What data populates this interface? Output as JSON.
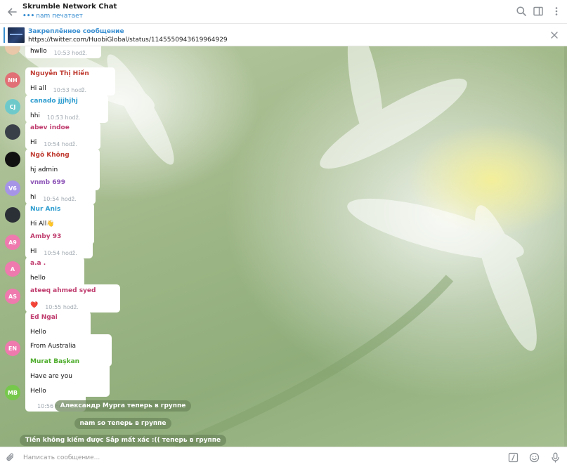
{
  "header": {
    "title": "Skrumble Network Chat",
    "typing_dots": "•••",
    "status": "nam печатает"
  },
  "pinned": {
    "title": "Закреплённое сообщение",
    "text": "https://twitter.com/HuobiGlobal/status/1145550943619964929"
  },
  "messages": [
    {
      "sender": "",
      "text": "hwllo",
      "time": "10:53 hodž.",
      "avatar": "",
      "avatar_color": "#e8c8a8",
      "name_color": "#c03d33"
    },
    {
      "sender": "Nguyễn Thị Hiền",
      "text": "Hi all",
      "time": "10:53 hodž.",
      "avatar": "NH",
      "avatar_color": "#e17076",
      "name_color": "#c03d33"
    },
    {
      "sender": "canado jjjhjhj",
      "text": "hhi",
      "time": "10:53 hodž.",
      "avatar": "CJ",
      "avatar_color": "#6ec9cb",
      "name_color": "#2c9ccf"
    },
    {
      "sender": "abev indoe",
      "text": "Hi",
      "time": "10:54 hodž.",
      "avatar": "",
      "avatar_color": "#3a4048",
      "name_color": "#c03d6e"
    },
    {
      "sender": "Ngô Không",
      "text": "hj admin",
      "time": "10:54 hodž.",
      "avatar": "",
      "avatar_color": "#111111",
      "name_color": "#c03d33"
    },
    {
      "sender": "vnmb 699",
      "text": "hi",
      "time": "10:54 hodž.",
      "avatar": "V6",
      "avatar_color": "#a695e7",
      "name_color": "#8e55b8"
    },
    {
      "sender": "Nur Anis",
      "text": "Hi All👋",
      "time": "10:54 hodž.",
      "avatar": "",
      "avatar_color": "#2b2f36",
      "name_color": "#2c9ccf"
    },
    {
      "sender": "Amby 93",
      "text": "Hi",
      "time": "10:54 hodž.",
      "avatar": "A9",
      "avatar_color": "#ee7aae",
      "name_color": "#c03d6e"
    },
    {
      "sender": "a.a .",
      "text": "hello",
      "time": "10:55 hodž.",
      "avatar": "A",
      "avatar_color": "#ee7aae",
      "name_color": "#c03d6e"
    },
    {
      "sender": "ateeq ahmed syed",
      "text": "❤️",
      "time": "10:55 hodž.",
      "avatar": "AS",
      "avatar_color": "#ee7aae",
      "name_color": "#c03d6e"
    },
    {
      "sender": "Ed Ngai",
      "text": "Hello",
      "time": "10:55 hodž.",
      "avatar": "",
      "avatar_color": "",
      "name_color": "#c03d6e"
    },
    {
      "sender": "",
      "text": "From Australia",
      "time": "10:55 hodž.",
      "avatar": "EN",
      "avatar_color": "#ee7aae",
      "name_color": "#c03d6e"
    },
    {
      "sender": "Murat Başkan",
      "text": "Have are you",
      "time": "10:55 hodž.",
      "avatar": "",
      "avatar_color": "",
      "name_color": "#4fad2d"
    },
    {
      "sender": "",
      "text": "Hello",
      "time": "10:56 hodž.",
      "avatar": "MB",
      "avatar_color": "#76c84d",
      "name_color": "#4fad2d"
    }
  ],
  "service": [
    "Александр Мурга теперь в группе",
    "nam so теперь в группе",
    "Tiền không kiếm được Sắp mất xác :(( теперь в группе"
  ],
  "composer": {
    "placeholder": "Написать сообщение..."
  },
  "colors": {
    "accent": "#3a8fd1",
    "service_bg": "#6d885e"
  }
}
